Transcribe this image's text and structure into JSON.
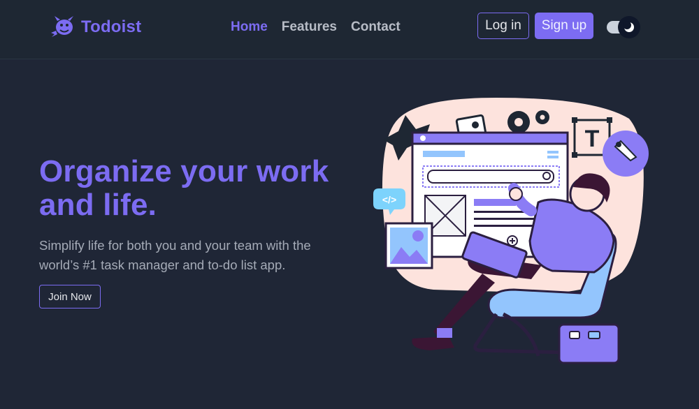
{
  "brand": {
    "name": "Todoist",
    "logo_icon": "devil-mascot-icon"
  },
  "nav": {
    "links": [
      {
        "label": "Home",
        "active": true
      },
      {
        "label": "Features",
        "active": false
      },
      {
        "label": "Contact",
        "active": false
      }
    ],
    "login_label": "Log in",
    "signup_label": "Sign up",
    "theme_toggle_icon": "moon-icon"
  },
  "hero": {
    "title": "Organize your work and life.",
    "subtitle": "Simplify life for both you and your team with the world’s #1 task manager and to-do list app.",
    "cta_label": "Join Now"
  },
  "illustration": {
    "letter_badge": "T",
    "code_badge": "</>"
  },
  "colors": {
    "background": "#1f2636",
    "navbar": "#1e2733",
    "accent": "#7c6cf2",
    "muted_text": "#a5abb7"
  }
}
